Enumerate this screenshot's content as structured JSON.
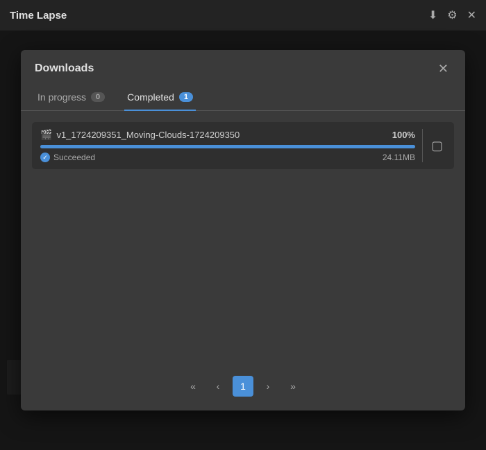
{
  "titleBar": {
    "title": "Time Lapse",
    "icons": {
      "download": "⬇",
      "settings": "⚙",
      "close": "✕"
    }
  },
  "modal": {
    "title": "Downloads",
    "closeLabel": "✕",
    "tabs": [
      {
        "id": "in-progress",
        "label": "In progress",
        "badge": "0",
        "active": false
      },
      {
        "id": "completed",
        "label": "Completed",
        "badge": "1",
        "active": true
      }
    ],
    "downloadItems": [
      {
        "filename": "v1_1724209351_Moving-Clouds-1724209350",
        "fileIcon": "🎬",
        "percent": "100%",
        "progressWidth": "100",
        "statusLabel": "Succeeded",
        "fileSize": "24.11MB"
      }
    ]
  },
  "pagination": {
    "firstLabel": "«",
    "prevLabel": "‹",
    "currentPage": "1",
    "nextLabel": "›",
    "lastLabel": "»"
  }
}
